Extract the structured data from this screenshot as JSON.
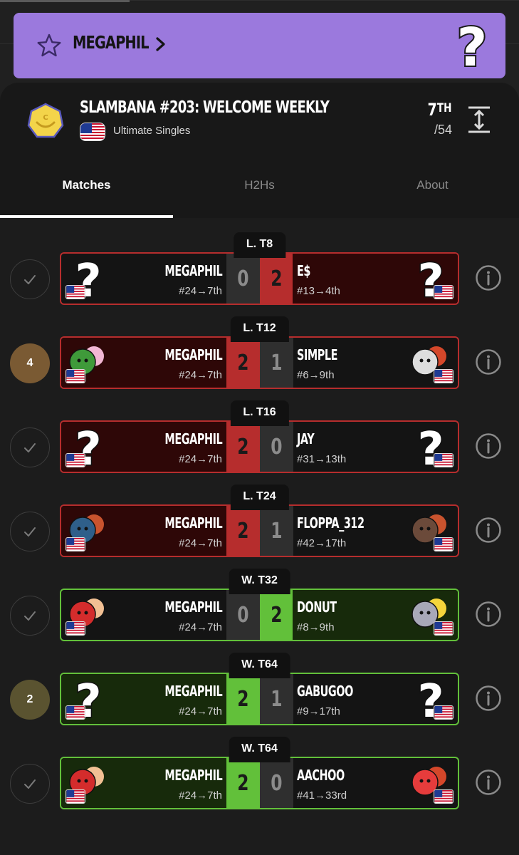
{
  "player": {
    "name": "MEGAPHIL",
    "avatar_icon": "question-mark-icon",
    "banner_color": "#9b79dd"
  },
  "tournament": {
    "name": "SLAMBANA #203: WELCOME WEEKLY",
    "game": "Ultimate Singles",
    "placement": "7",
    "placement_suffix": "TH",
    "entrants": "/54"
  },
  "tabs": [
    "Matches",
    "H2Hs",
    "About"
  ],
  "active_tab": "Matches",
  "matches": [
    {
      "round": "L. T8",
      "status": "check",
      "left_name": "MEGAPHIL",
      "left_seed": "#24→7th",
      "left_score": "0",
      "right_name": "E$",
      "right_seed": "#13→4th",
      "right_score": "2",
      "winner": "right",
      "bracket": "losers"
    },
    {
      "round": "L. T12",
      "status": "4",
      "left_name": "MEGAPHIL",
      "left_seed": "#24→7th",
      "left_score": "2",
      "right_name": "SIMPLE",
      "right_seed": "#6→9th",
      "right_score": "1",
      "winner": "left",
      "bracket": "losers"
    },
    {
      "round": "L. T16",
      "status": "check",
      "left_name": "MEGAPHIL",
      "left_seed": "#24→7th",
      "left_score": "2",
      "right_name": "JAY",
      "right_seed": "#31→13th",
      "right_score": "0",
      "winner": "left",
      "bracket": "losers"
    },
    {
      "round": "L. T24",
      "status": "check",
      "left_name": "MEGAPHIL",
      "left_seed": "#24→7th",
      "left_score": "2",
      "right_name": "FLOPPA_312",
      "right_seed": "#42→17th",
      "right_score": "1",
      "winner": "left",
      "bracket": "losers"
    },
    {
      "round": "W. T32",
      "status": "check",
      "left_name": "MEGAPHIL",
      "left_seed": "#24→7th",
      "left_score": "0",
      "right_name": "DONUT",
      "right_seed": "#8→9th",
      "right_score": "2",
      "winner": "right",
      "bracket": "winners"
    },
    {
      "round": "W. T64",
      "status": "2",
      "left_name": "MEGAPHIL",
      "left_seed": "#24→7th",
      "left_score": "2",
      "right_name": "GABUGOO",
      "right_seed": "#9→17th",
      "right_score": "1",
      "winner": "left",
      "bracket": "winners"
    },
    {
      "round": "W. T64",
      "status": "check",
      "left_name": "MEGAPHIL",
      "left_seed": "#24→7th",
      "left_score": "2",
      "right_name": "AACHOO",
      "right_seed": "#41→33rd",
      "right_score": "0",
      "winner": "left",
      "bracket": "winners"
    }
  ],
  "colors": {
    "loss_red": "#b62d2d",
    "win_green": "#62c03a",
    "status_bronze": "#7a5a33",
    "status_olive": "#5a5330"
  }
}
